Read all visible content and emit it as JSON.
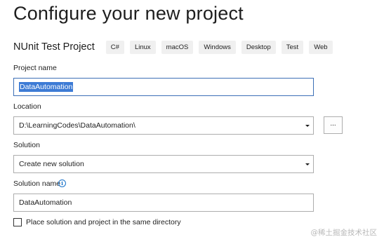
{
  "page": {
    "title": "Configure your new project"
  },
  "template": {
    "name": "NUnit Test Project",
    "tags": [
      "C#",
      "Linux",
      "macOS",
      "Windows",
      "Desktop",
      "Test",
      "Web"
    ]
  },
  "project_name": {
    "label": "Project name",
    "value": "DataAutomation"
  },
  "location": {
    "label": "Location",
    "value": "D:\\LearningCodes\\DataAutomation\\",
    "browse_label": "..."
  },
  "solution": {
    "label": "Solution",
    "value": "Create new solution"
  },
  "solution_name": {
    "label": "Solution name",
    "info_icon": "i",
    "value": "DataAutomation"
  },
  "same_directory": {
    "label": "Place solution and project in the same directory",
    "checked": false
  },
  "watermark": {
    "text": "@稀土掘金技术社区"
  },
  "colors": {
    "selection": "#3d7bd5",
    "focus_border": "#3c6fb6",
    "info_icon": "#1a73c9",
    "tag_background": "#f0f0f0"
  },
  "icons": {
    "combo_arrow": "chevron-down-icon",
    "info": "info-icon"
  }
}
